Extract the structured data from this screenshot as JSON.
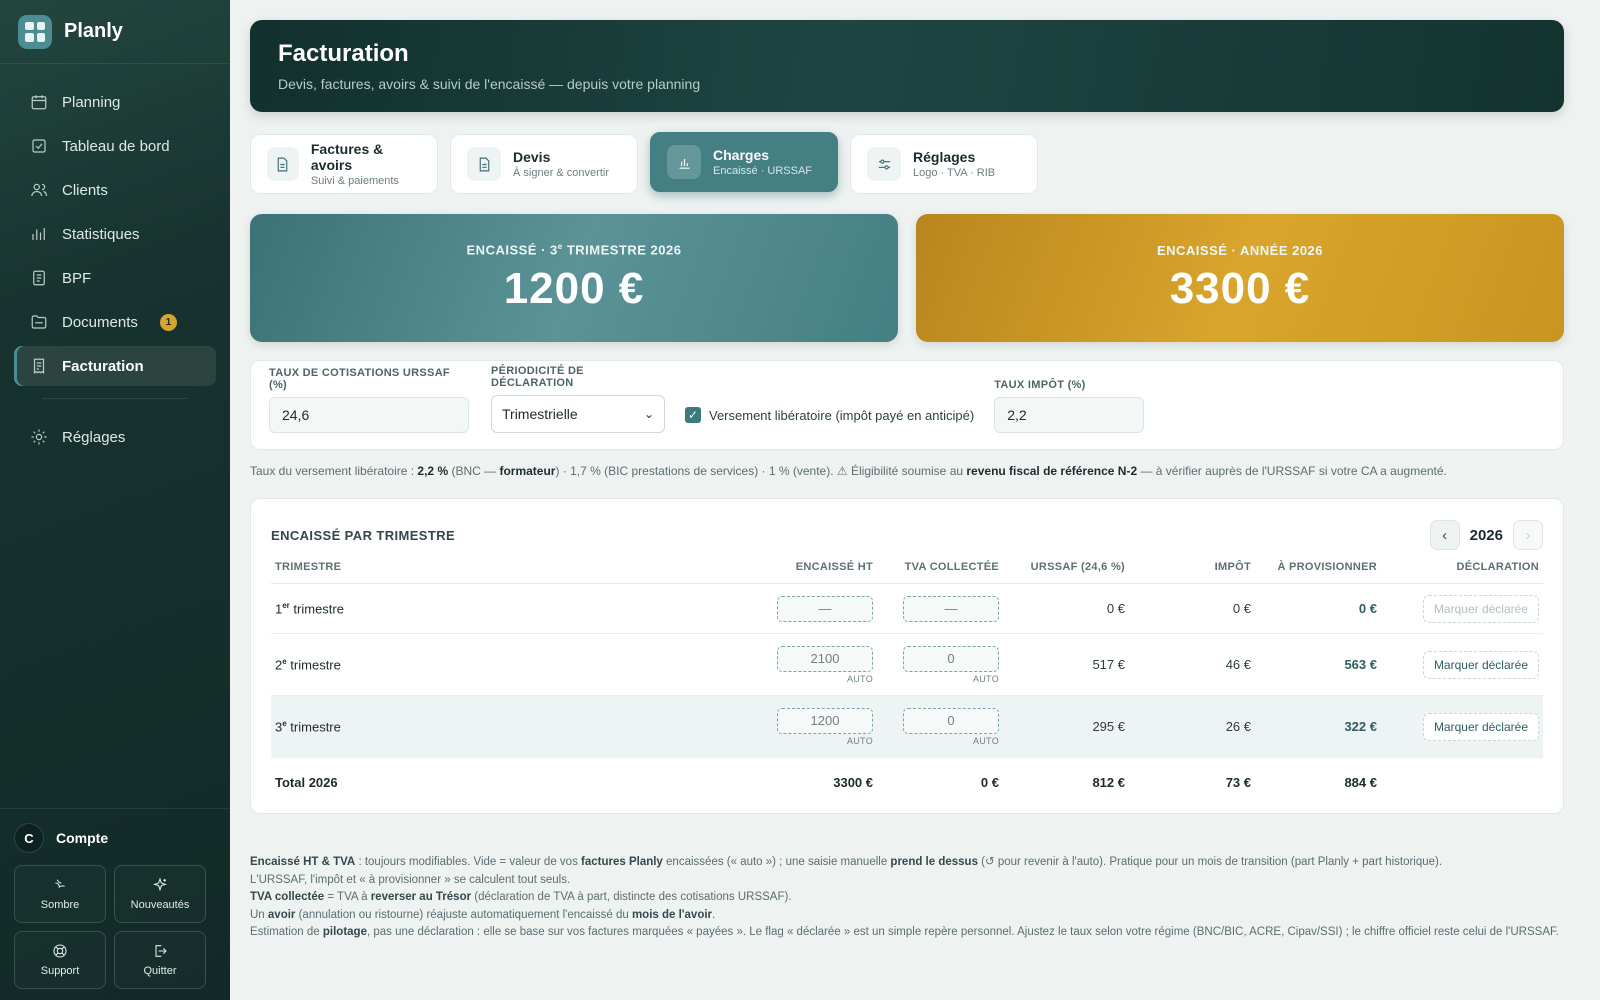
{
  "app": {
    "name": "Planly"
  },
  "sidebar": {
    "items": [
      {
        "label": "Planning",
        "icon": "calendar-icon"
      },
      {
        "label": "Tableau de bord",
        "icon": "checkbox-icon"
      },
      {
        "label": "Clients",
        "icon": "users-icon"
      },
      {
        "label": "Statistiques",
        "icon": "bar-chart-icon"
      },
      {
        "label": "BPF",
        "icon": "document-icon"
      },
      {
        "label": "Documents",
        "icon": "folder-icon",
        "badge": "1"
      },
      {
        "label": "Facturation",
        "icon": "receipt-icon",
        "active": true
      }
    ],
    "settings": {
      "label": "Réglages",
      "icon": "sun-gear-icon"
    },
    "account": {
      "initial": "C",
      "label": "Compte",
      "buttons": [
        {
          "label": "Sombre",
          "icon": "moon-icon"
        },
        {
          "label": "Nouveautés",
          "icon": "sparkle-icon"
        },
        {
          "label": "Support",
          "icon": "lifebuoy-icon"
        },
        {
          "label": "Quitter",
          "icon": "logout-icon"
        }
      ]
    }
  },
  "header": {
    "title": "Facturation",
    "subtitle": "Devis, factures, avoirs & suivi de l'encaissé — depuis votre planning"
  },
  "tabs": [
    {
      "title": "Factures & avoirs",
      "sub": "Suivi & paiements",
      "icon": "file-icon"
    },
    {
      "title": "Devis",
      "sub": "À signer & convertir",
      "icon": "file-icon"
    },
    {
      "title": "Charges",
      "sub": "Encaissé · URSSAF",
      "icon": "bar-chart-icon",
      "active": true
    },
    {
      "title": "Réglages",
      "sub": "Logo · TVA · RIB",
      "icon": "sliders-icon"
    }
  ],
  "kpis": {
    "quarter": {
      "label_prefix": "ENCAISSÉ · 3",
      "label_sup": "e",
      "label_suffix": " TRIMESTRE 2026",
      "value": "1200 €",
      "color": "#447f84"
    },
    "year": {
      "label": "ENCAISSÉ · ANNÉE 2026",
      "value": "3300 €",
      "color": "#d29f2a"
    }
  },
  "settings": {
    "urssaf_label": "TAUX DE COTISATIONS URSSAF (%)",
    "urssaf_value": "24,6",
    "period_label": "PÉRIODICITÉ DE DÉCLARATION",
    "period_value": "Trimestrielle",
    "liberatoire_label": "Versement libératoire (impôt payé en anticipé)",
    "liberatoire_checked": true,
    "tax_label": "TAUX IMPÔT (%)",
    "tax_value": "2,2"
  },
  "note": {
    "t1": "Taux du versement libératoire : ",
    "b1": "2,2 %",
    "t2": " (BNC — ",
    "b2": "formateur",
    "t3": ") · 1,7 % (BIC prestations de services) · 1 % (vente). ⚠ Éligibilité soumise au ",
    "b3": "revenu fiscal de référence N-2",
    "t4": " — à vérifier auprès de l'URSSAF si votre CA a augmenté."
  },
  "table": {
    "title": "ENCAISSÉ PAR TRIMESTRE",
    "year": "2026",
    "prev_icon": "‹",
    "next_icon": "›",
    "headers": [
      "TRIMESTRE",
      "ENCAISSÉ HT",
      "TVA COLLECTÉE",
      "URSSAF (24,6 %)",
      "IMPÔT",
      "À PROVISIONNER",
      "DÉCLARATION"
    ],
    "auto_label": "AUTO",
    "rows": [
      {
        "num": "1",
        "sup": "er",
        "label": " trimestre",
        "ht": "—",
        "tva": "—",
        "urssaf": "0 €",
        "impot": "0 €",
        "prov": "0 €",
        "action": "Marquer déclarée",
        "disabled": true
      },
      {
        "num": "2",
        "sup": "e",
        "label": " trimestre",
        "ht": "2100",
        "tva": "0",
        "urssaf": "517 €",
        "impot": "46 €",
        "prov": "563 €",
        "action": "Marquer déclarée"
      },
      {
        "num": "3",
        "sup": "e",
        "label": " trimestre",
        "ht": "1200",
        "tva": "0",
        "urssaf": "295 €",
        "impot": "26 €",
        "prov": "322 €",
        "action": "Marquer déclarée",
        "highlight": true
      }
    ],
    "total": {
      "label": "Total 2026",
      "ht": "3300 €",
      "tva": "0 €",
      "urssaf": "812 €",
      "impot": "73 €",
      "prov": "884 €"
    }
  },
  "footer": {
    "l1_b1": "Encaissé HT & TVA",
    "l1_t1": " : toujours modifiables. Vide = valeur de vos ",
    "l1_b2": "factures Planly",
    "l1_t2": " encaissées (« auto ») ; une saisie manuelle ",
    "l1_b3": "prend le dessus",
    "l1_t3": " (↺ pour revenir à l'auto). Pratique pour un mois de transition (part Planly + part historique).",
    "l2": "L'URSSAF, l'impôt et « à provisionner » se calculent tout seuls.",
    "l3_b1": "TVA collectée",
    "l3_t1": " = TVA à ",
    "l3_b2": "reverser au Trésor",
    "l3_t2": " (déclaration de TVA à part, distincte des cotisations URSSAF).",
    "l4_t1": "Un ",
    "l4_b1": "avoir",
    "l4_t2": " (annulation ou ristourne) réajuste automatiquement l'encaissé du ",
    "l4_b2": "mois de l'avoir",
    "l4_t3": ".",
    "l5_t1": "Estimation de ",
    "l5_b1": "pilotage",
    "l5_t2": ", pas une déclaration : elle se base sur vos factures marquées « payées ». Le flag « déclarée » est un simple repère personnel. Ajustez le taux selon votre régime (BNC/BIC, ACRE, Cipav/SSI) ; le chiffre officiel reste celui de l'URSSAF."
  }
}
